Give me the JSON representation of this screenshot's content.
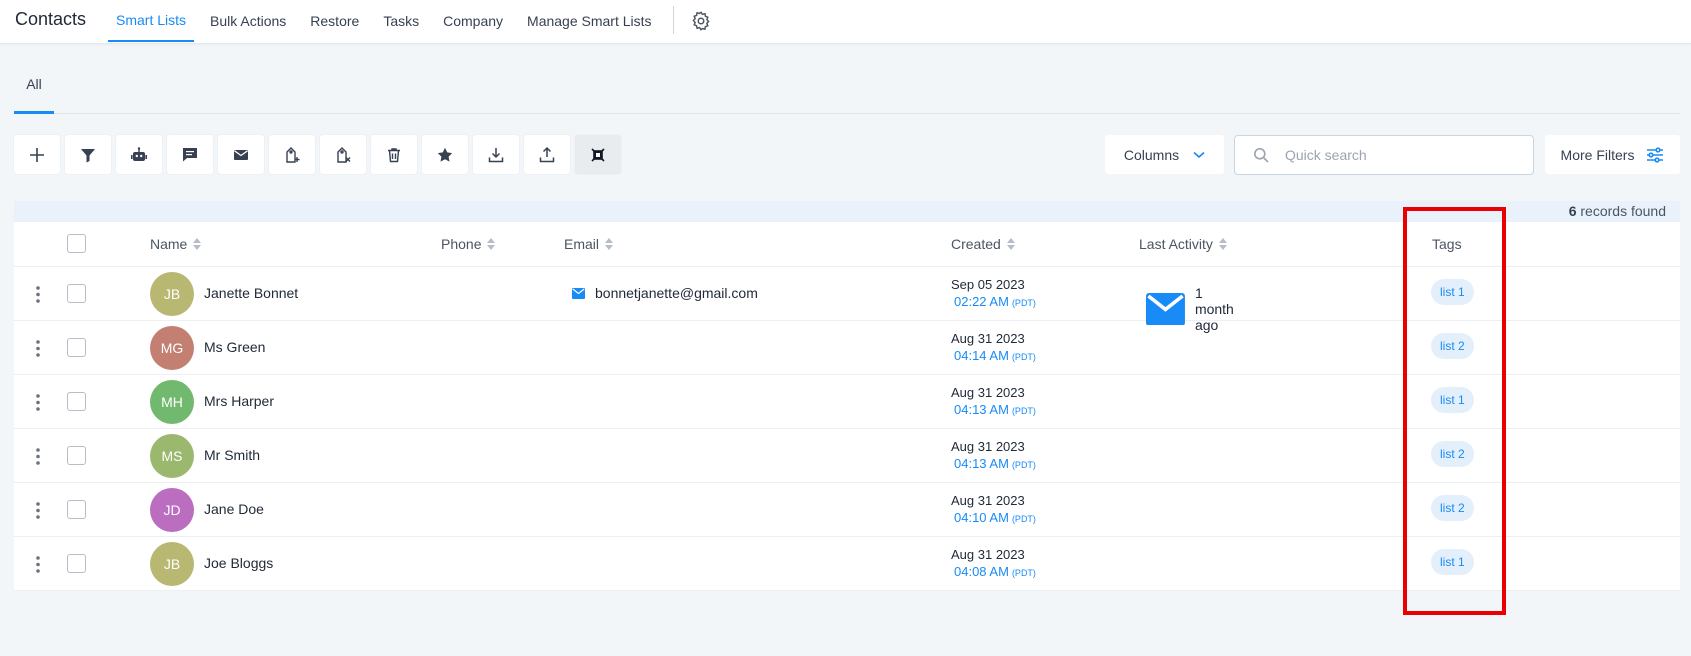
{
  "header": {
    "title": "Contacts",
    "nav": [
      {
        "label": "Smart Lists",
        "active": true
      },
      {
        "label": "Bulk Actions",
        "active": false
      },
      {
        "label": "Restore",
        "active": false
      },
      {
        "label": "Tasks",
        "active": false
      },
      {
        "label": "Company",
        "active": false
      },
      {
        "label": "Manage Smart Lists",
        "active": false
      }
    ]
  },
  "subtabs": {
    "all": "All"
  },
  "toolbar": {
    "icons": [
      "plus-icon",
      "filter-icon",
      "robot-icon",
      "message-icon",
      "mail-icon",
      "tag-add-icon",
      "tag-remove-icon",
      "trash-icon",
      "star-icon",
      "import-icon",
      "export-icon",
      "merge-icon"
    ],
    "columns_label": "Columns",
    "search_placeholder": "Quick search",
    "more_filters_label": "More Filters"
  },
  "records": {
    "count": "6",
    "suffix": "records found"
  },
  "table": {
    "headers": {
      "name": "Name",
      "phone": "Phone",
      "email": "Email",
      "created": "Created",
      "last_activity": "Last Activity",
      "tags": "Tags"
    },
    "rows": [
      {
        "initials": "JB",
        "avatar_color": "#b9b872",
        "name": "Janette Bonnet",
        "email": "bonnetjanette@gmail.com",
        "created_date": "Sep 05 2023",
        "created_time": "02:22 AM",
        "tz": "(PDT)",
        "last_activity": "1 month ago",
        "tag": "list 1"
      },
      {
        "initials": "MG",
        "avatar_color": "#c27f72",
        "name": "Ms Green",
        "email": "",
        "created_date": "Aug 31 2023",
        "created_time": "04:14 AM",
        "tz": "(PDT)",
        "last_activity": "",
        "tag": "list 2"
      },
      {
        "initials": "MH",
        "avatar_color": "#71b96e",
        "name": "Mrs Harper",
        "email": "",
        "created_date": "Aug 31 2023",
        "created_time": "04:13 AM",
        "tz": "(PDT)",
        "last_activity": "",
        "tag": "list 1"
      },
      {
        "initials": "MS",
        "avatar_color": "#9bb86f",
        "name": "Mr Smith",
        "email": "",
        "created_date": "Aug 31 2023",
        "created_time": "04:13 AM",
        "tz": "(PDT)",
        "last_activity": "",
        "tag": "list 2"
      },
      {
        "initials": "JD",
        "avatar_color": "#bb6ec0",
        "name": "Jane Doe",
        "email": "",
        "created_date": "Aug 31 2023",
        "created_time": "04:10 AM",
        "tz": "(PDT)",
        "last_activity": "",
        "tag": "list 2"
      },
      {
        "initials": "JB",
        "avatar_color": "#b9b872",
        "name": "Joe Bloggs",
        "email": "",
        "created_date": "Aug 31 2023",
        "created_time": "04:08 AM",
        "tz": "(PDT)",
        "last_activity": "",
        "tag": "list 1"
      }
    ]
  },
  "colors": {
    "accent": "#188bf6",
    "highlight": "#ea0000"
  }
}
